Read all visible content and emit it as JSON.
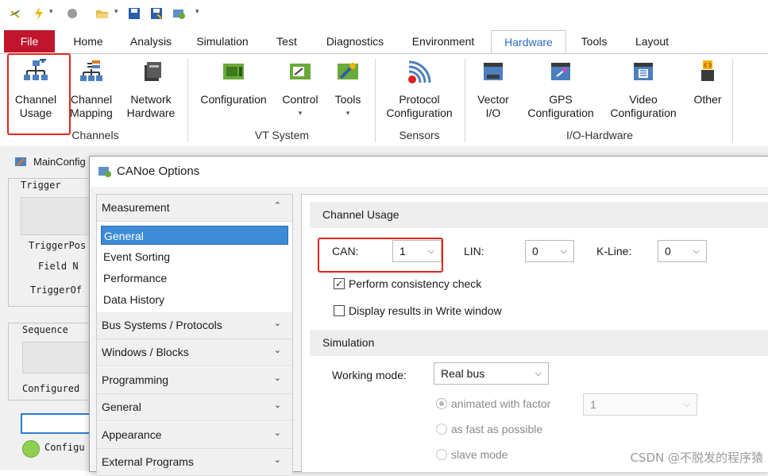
{
  "ribbon_tabs": [
    "File",
    "Home",
    "Analysis",
    "Simulation",
    "Test",
    "Diagnostics",
    "Environment",
    "Hardware",
    "Tools",
    "Layout"
  ],
  "active_tab": "Hardware",
  "ribbon": {
    "channels": {
      "label": "Channels",
      "buttons": [
        {
          "line1": "Channel",
          "line2": "Usage"
        },
        {
          "line1": "Channel",
          "line2": "Mapping"
        },
        {
          "line1": "Network",
          "line2": "Hardware"
        }
      ]
    },
    "vt_system": {
      "label": "VT System",
      "buttons": [
        {
          "line1": "Configuration",
          "line2": ""
        },
        {
          "line1": "Control",
          "line2": "▾"
        },
        {
          "line1": "Tools",
          "line2": "▾"
        }
      ]
    },
    "sensors": {
      "label": "Sensors",
      "buttons": [
        {
          "line1": "Protocol",
          "line2": "Configuration"
        }
      ]
    },
    "io_hardware": {
      "label": "I/O-Hardware",
      "buttons": [
        {
          "line1": "Vector",
          "line2": "I/O"
        },
        {
          "line1": "GPS",
          "line2": "Configuration"
        },
        {
          "line1": "Video",
          "line2": "Configuration"
        },
        {
          "line1": "Other",
          "line2": ""
        }
      ]
    }
  },
  "background_window": {
    "title": "MainConfig",
    "trigger_label": "Trigger",
    "trigger_pos": "TriggerPos",
    "field_n": "Field N",
    "trigger_of": "TriggerOf",
    "sequence_label": "Sequence",
    "configured": "Configured",
    "config_status": "Configu"
  },
  "dialog": {
    "title": "CANoe Options",
    "nav": {
      "measurement": {
        "label": "Measurement",
        "items": [
          "General",
          "Event Sorting",
          "Performance",
          "Data History"
        ],
        "selected": "General"
      },
      "collapsed": [
        "Bus Systems / Protocols",
        "Windows / Blocks",
        "Programming",
        "General",
        "Appearance",
        "External Programs"
      ]
    },
    "channel_usage": {
      "header": "Channel Usage",
      "can_label": "CAN:",
      "can_value": "1",
      "lin_label": "LIN:",
      "lin_value": "0",
      "kline_label": "K-Line:",
      "kline_value": "0",
      "consistency_label": "Perform consistency check",
      "consistency_checked": true,
      "display_results_label": "Display results in Write window",
      "display_results_checked": false
    },
    "simulation": {
      "header": "Simulation",
      "working_mode_label": "Working mode:",
      "working_mode_value": "Real bus",
      "animated_label": "animated with factor",
      "animated_factor": "1",
      "fast_label": "as fast as possible",
      "slave_label": "slave mode"
    }
  },
  "watermark": "CSDN @不脱发的程序猿",
  "colors": {
    "file_tab": "#c0152d",
    "active_tab_text": "#2b6cc4",
    "selection": "#3d8bd4",
    "highlight_box": "#e0251b"
  }
}
